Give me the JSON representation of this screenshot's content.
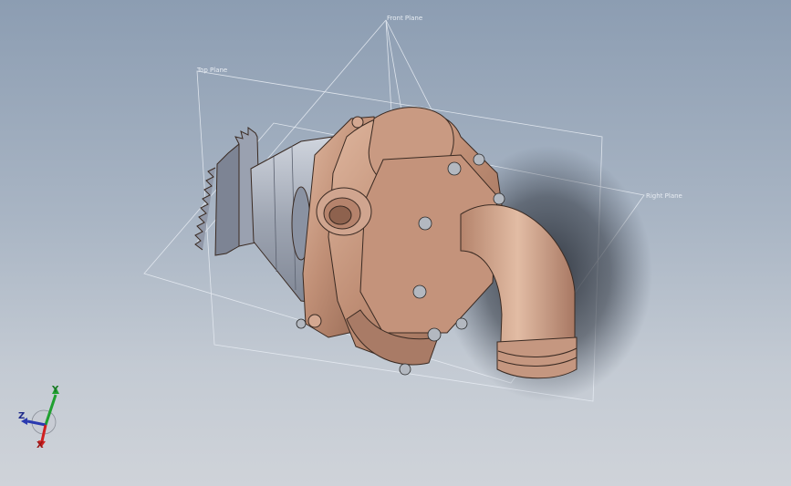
{
  "viewport": {
    "background_top": "#8c9db2",
    "background_bottom": "#cfd3d9"
  },
  "planes": {
    "front": "Front Plane",
    "top": "Top Plane",
    "right": "Right Plane"
  },
  "model": {
    "body_color": "#c08f76",
    "gear_color": "#8f96a6",
    "shaft_color": "#b5bcc9",
    "bolt_color": "#9aa0a8"
  },
  "triad": {
    "x": "X",
    "y": "Y",
    "z": "Z",
    "x_color": "#d02020",
    "y_color": "#20a030",
    "z_color": "#2a3ab0"
  }
}
